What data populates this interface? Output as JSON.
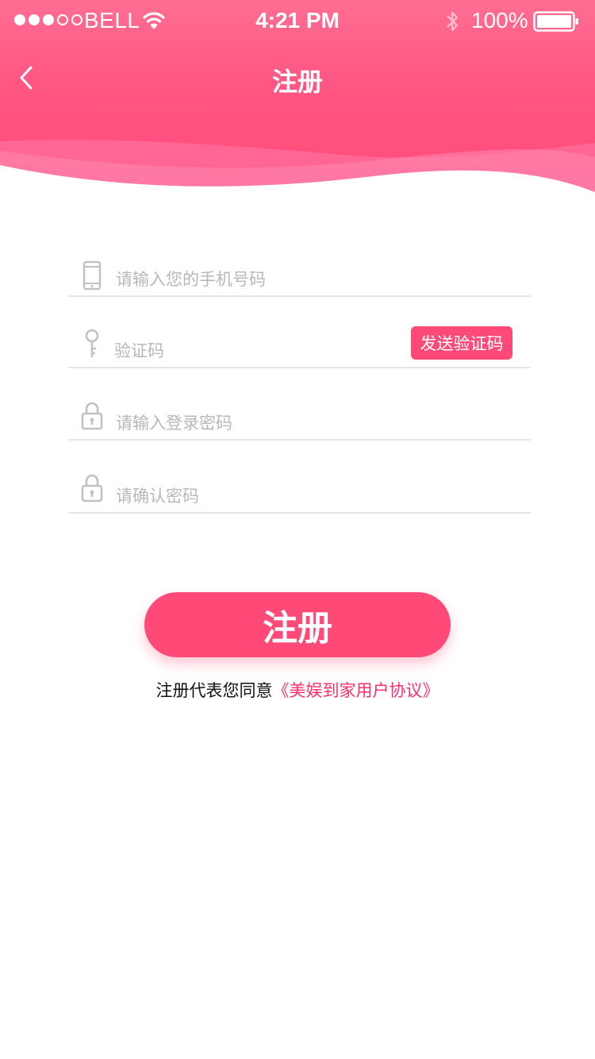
{
  "status_bar": {
    "carrier": "BELL",
    "time": "4:21 PM",
    "battery": "100%",
    "signal_strength": 3,
    "signal_max": 5
  },
  "header": {
    "title": "注册"
  },
  "form": {
    "phone_placeholder": "请输入您的手机号码",
    "code_placeholder": "验证码",
    "send_code_label": "发送验证码",
    "password_placeholder": "请输入登录密码",
    "confirm_placeholder": "请确认密码"
  },
  "register_label": "注册",
  "agreement": {
    "prefix": "注册代表您同意",
    "link": "《美娱到家用户协议》"
  },
  "colors": {
    "accent": "#ff4a78",
    "link": "#ff2e6a",
    "header_top": "#ff6e92",
    "placeholder": "#b8b8b8",
    "divider": "#e6e6e6"
  },
  "icons": [
    "back-chevron-icon",
    "phone-icon",
    "key-icon",
    "lock-icon",
    "wifi-icon",
    "bluetooth-icon",
    "battery-icon"
  ]
}
